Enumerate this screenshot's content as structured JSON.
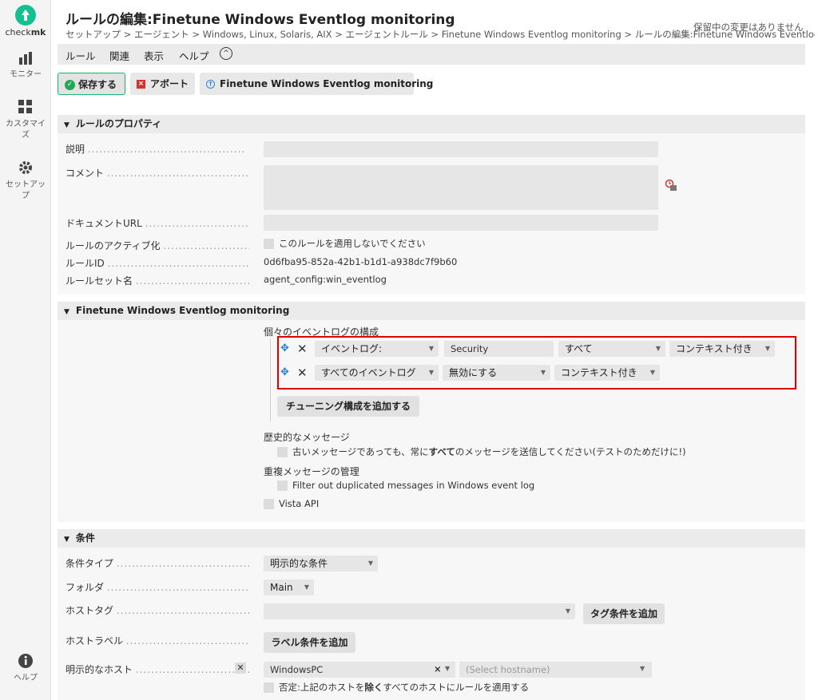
{
  "sidebar": {
    "logo_bold": "mk",
    "logo_prefix": "check",
    "items": [
      {
        "label": "モニター",
        "icon": "bar-chart-icon"
      },
      {
        "label": "カスタマイズ",
        "icon": "grid-icon"
      },
      {
        "label": "セットアップ",
        "icon": "gear-icon"
      },
      {
        "label": "ヘルプ",
        "icon": "info-icon"
      }
    ]
  },
  "header": {
    "title": "ルールの編集:Finetune Windows Eventlog monitoring",
    "breadcrumb": "セットアップ > エージェント > Windows, Linux, Solaris, AIX > エージェントルール > Finetune Windows Eventlog monitoring > ルールの編集:Finetune Windows Eventlog m",
    "pending": "保留中の変更はありません"
  },
  "menu": [
    "ルール",
    "関連",
    "表示",
    "ヘルプ"
  ],
  "actions": {
    "save": "保存する",
    "abort": "アボート",
    "finetune": "Finetune Windows Eventlog monitoring"
  },
  "properties": {
    "heading": "ルールのプロパティ",
    "description_label": "説明",
    "comment_label": "コメント",
    "doc_url_label": "ドキュメントURL",
    "activation_label": "ルールのアクティブ化",
    "activation_checkbox": "このルールを適用しないでください",
    "rule_id_label": "ルールID",
    "rule_id": "0d6fba95-852a-42b1-b1d1-a938dc7f9b60",
    "ruleset_label": "ルールセット名",
    "ruleset": "agent_config:win_eventlog"
  },
  "finetune": {
    "heading": "Finetune Windows Eventlog monitoring",
    "config_label": "個々のイベントログの構成",
    "entries": [
      {
        "type": "イベントログ:",
        "name": "Security",
        "level": "すべて",
        "context": "コンテキスト付き"
      },
      {
        "type": "すべてのイベントログ",
        "level": "無効にする",
        "context": "コンテキスト付き"
      }
    ],
    "add_button": "チューニング構成を追加する",
    "history_label": "歴史的なメッセージ",
    "history_checkbox_pre": "古いメッセージであっても、常に",
    "history_checkbox_bold": "すべて",
    "history_checkbox_post": "のメッセージを送信してください(テストのためだけに!)",
    "duplicate_label": "重複メッセージの管理",
    "duplicate_checkbox": "Filter out duplicated messages in Windows event log",
    "vista_api": "Vista API"
  },
  "conditions": {
    "heading": "条件",
    "condition_type_label": "条件タイプ",
    "condition_type_value": "明示的な条件",
    "folder_label": "フォルダ",
    "folder_value": "Main",
    "host_tags_label": "ホストタグ",
    "add_tag_button": "タグ条件を追加",
    "host_labels_label": "ホストラベル",
    "add_label_button": "ラベル条件を追加",
    "explicit_hosts_label": "明示的なホスト",
    "host_value": "WindowsPC",
    "host_placeholder": "(Select hostname)",
    "negate_pre": "否定:",
    "negate_mid": "上記のホストを",
    "negate_bold": "除く",
    "negate_post": "すべてのホストにルールを適用する"
  }
}
